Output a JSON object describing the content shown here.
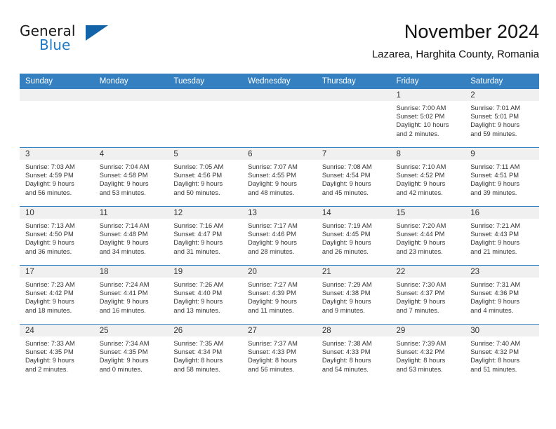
{
  "brand": {
    "name_part1": "General",
    "name_part2": "Blue",
    "logo_icon": "triangle-logo-icon"
  },
  "header": {
    "title": "November 2024",
    "subtitle": "Lazarea, Harghita County, Romania"
  },
  "colors": {
    "header_blue": "#3580c0",
    "brand_blue": "#1f7ac4",
    "logo_blue": "#1263a8",
    "daynum_strip": "#f0f0f0",
    "text": "#333333"
  },
  "weekdays": [
    "Sunday",
    "Monday",
    "Tuesday",
    "Wednesday",
    "Thursday",
    "Friday",
    "Saturday"
  ],
  "weeks": [
    [
      {
        "day": "",
        "sunrise": "",
        "sunset": "",
        "daylight1": "",
        "daylight2": ""
      },
      {
        "day": "",
        "sunrise": "",
        "sunset": "",
        "daylight1": "",
        "daylight2": ""
      },
      {
        "day": "",
        "sunrise": "",
        "sunset": "",
        "daylight1": "",
        "daylight2": ""
      },
      {
        "day": "",
        "sunrise": "",
        "sunset": "",
        "daylight1": "",
        "daylight2": ""
      },
      {
        "day": "",
        "sunrise": "",
        "sunset": "",
        "daylight1": "",
        "daylight2": ""
      },
      {
        "day": "1",
        "sunrise": "Sunrise: 7:00 AM",
        "sunset": "Sunset: 5:02 PM",
        "daylight1": "Daylight: 10 hours",
        "daylight2": "and 2 minutes."
      },
      {
        "day": "2",
        "sunrise": "Sunrise: 7:01 AM",
        "sunset": "Sunset: 5:01 PM",
        "daylight1": "Daylight: 9 hours",
        "daylight2": "and 59 minutes."
      }
    ],
    [
      {
        "day": "3",
        "sunrise": "Sunrise: 7:03 AM",
        "sunset": "Sunset: 4:59 PM",
        "daylight1": "Daylight: 9 hours",
        "daylight2": "and 56 minutes."
      },
      {
        "day": "4",
        "sunrise": "Sunrise: 7:04 AM",
        "sunset": "Sunset: 4:58 PM",
        "daylight1": "Daylight: 9 hours",
        "daylight2": "and 53 minutes."
      },
      {
        "day": "5",
        "sunrise": "Sunrise: 7:05 AM",
        "sunset": "Sunset: 4:56 PM",
        "daylight1": "Daylight: 9 hours",
        "daylight2": "and 50 minutes."
      },
      {
        "day": "6",
        "sunrise": "Sunrise: 7:07 AM",
        "sunset": "Sunset: 4:55 PM",
        "daylight1": "Daylight: 9 hours",
        "daylight2": "and 48 minutes."
      },
      {
        "day": "7",
        "sunrise": "Sunrise: 7:08 AM",
        "sunset": "Sunset: 4:54 PM",
        "daylight1": "Daylight: 9 hours",
        "daylight2": "and 45 minutes."
      },
      {
        "day": "8",
        "sunrise": "Sunrise: 7:10 AM",
        "sunset": "Sunset: 4:52 PM",
        "daylight1": "Daylight: 9 hours",
        "daylight2": "and 42 minutes."
      },
      {
        "day": "9",
        "sunrise": "Sunrise: 7:11 AM",
        "sunset": "Sunset: 4:51 PM",
        "daylight1": "Daylight: 9 hours",
        "daylight2": "and 39 minutes."
      }
    ],
    [
      {
        "day": "10",
        "sunrise": "Sunrise: 7:13 AM",
        "sunset": "Sunset: 4:50 PM",
        "daylight1": "Daylight: 9 hours",
        "daylight2": "and 36 minutes."
      },
      {
        "day": "11",
        "sunrise": "Sunrise: 7:14 AM",
        "sunset": "Sunset: 4:48 PM",
        "daylight1": "Daylight: 9 hours",
        "daylight2": "and 34 minutes."
      },
      {
        "day": "12",
        "sunrise": "Sunrise: 7:16 AM",
        "sunset": "Sunset: 4:47 PM",
        "daylight1": "Daylight: 9 hours",
        "daylight2": "and 31 minutes."
      },
      {
        "day": "13",
        "sunrise": "Sunrise: 7:17 AM",
        "sunset": "Sunset: 4:46 PM",
        "daylight1": "Daylight: 9 hours",
        "daylight2": "and 28 minutes."
      },
      {
        "day": "14",
        "sunrise": "Sunrise: 7:19 AM",
        "sunset": "Sunset: 4:45 PM",
        "daylight1": "Daylight: 9 hours",
        "daylight2": "and 26 minutes."
      },
      {
        "day": "15",
        "sunrise": "Sunrise: 7:20 AM",
        "sunset": "Sunset: 4:44 PM",
        "daylight1": "Daylight: 9 hours",
        "daylight2": "and 23 minutes."
      },
      {
        "day": "16",
        "sunrise": "Sunrise: 7:21 AM",
        "sunset": "Sunset: 4:43 PM",
        "daylight1": "Daylight: 9 hours",
        "daylight2": "and 21 minutes."
      }
    ],
    [
      {
        "day": "17",
        "sunrise": "Sunrise: 7:23 AM",
        "sunset": "Sunset: 4:42 PM",
        "daylight1": "Daylight: 9 hours",
        "daylight2": "and 18 minutes."
      },
      {
        "day": "18",
        "sunrise": "Sunrise: 7:24 AM",
        "sunset": "Sunset: 4:41 PM",
        "daylight1": "Daylight: 9 hours",
        "daylight2": "and 16 minutes."
      },
      {
        "day": "19",
        "sunrise": "Sunrise: 7:26 AM",
        "sunset": "Sunset: 4:40 PM",
        "daylight1": "Daylight: 9 hours",
        "daylight2": "and 13 minutes."
      },
      {
        "day": "20",
        "sunrise": "Sunrise: 7:27 AM",
        "sunset": "Sunset: 4:39 PM",
        "daylight1": "Daylight: 9 hours",
        "daylight2": "and 11 minutes."
      },
      {
        "day": "21",
        "sunrise": "Sunrise: 7:29 AM",
        "sunset": "Sunset: 4:38 PM",
        "daylight1": "Daylight: 9 hours",
        "daylight2": "and 9 minutes."
      },
      {
        "day": "22",
        "sunrise": "Sunrise: 7:30 AM",
        "sunset": "Sunset: 4:37 PM",
        "daylight1": "Daylight: 9 hours",
        "daylight2": "and 7 minutes."
      },
      {
        "day": "23",
        "sunrise": "Sunrise: 7:31 AM",
        "sunset": "Sunset: 4:36 PM",
        "daylight1": "Daylight: 9 hours",
        "daylight2": "and 4 minutes."
      }
    ],
    [
      {
        "day": "24",
        "sunrise": "Sunrise: 7:33 AM",
        "sunset": "Sunset: 4:35 PM",
        "daylight1": "Daylight: 9 hours",
        "daylight2": "and 2 minutes."
      },
      {
        "day": "25",
        "sunrise": "Sunrise: 7:34 AM",
        "sunset": "Sunset: 4:35 PM",
        "daylight1": "Daylight: 9 hours",
        "daylight2": "and 0 minutes."
      },
      {
        "day": "26",
        "sunrise": "Sunrise: 7:35 AM",
        "sunset": "Sunset: 4:34 PM",
        "daylight1": "Daylight: 8 hours",
        "daylight2": "and 58 minutes."
      },
      {
        "day": "27",
        "sunrise": "Sunrise: 7:37 AM",
        "sunset": "Sunset: 4:33 PM",
        "daylight1": "Daylight: 8 hours",
        "daylight2": "and 56 minutes."
      },
      {
        "day": "28",
        "sunrise": "Sunrise: 7:38 AM",
        "sunset": "Sunset: 4:33 PM",
        "daylight1": "Daylight: 8 hours",
        "daylight2": "and 54 minutes."
      },
      {
        "day": "29",
        "sunrise": "Sunrise: 7:39 AM",
        "sunset": "Sunset: 4:32 PM",
        "daylight1": "Daylight: 8 hours",
        "daylight2": "and 53 minutes."
      },
      {
        "day": "30",
        "sunrise": "Sunrise: 7:40 AM",
        "sunset": "Sunset: 4:32 PM",
        "daylight1": "Daylight: 8 hours",
        "daylight2": "and 51 minutes."
      }
    ]
  ]
}
